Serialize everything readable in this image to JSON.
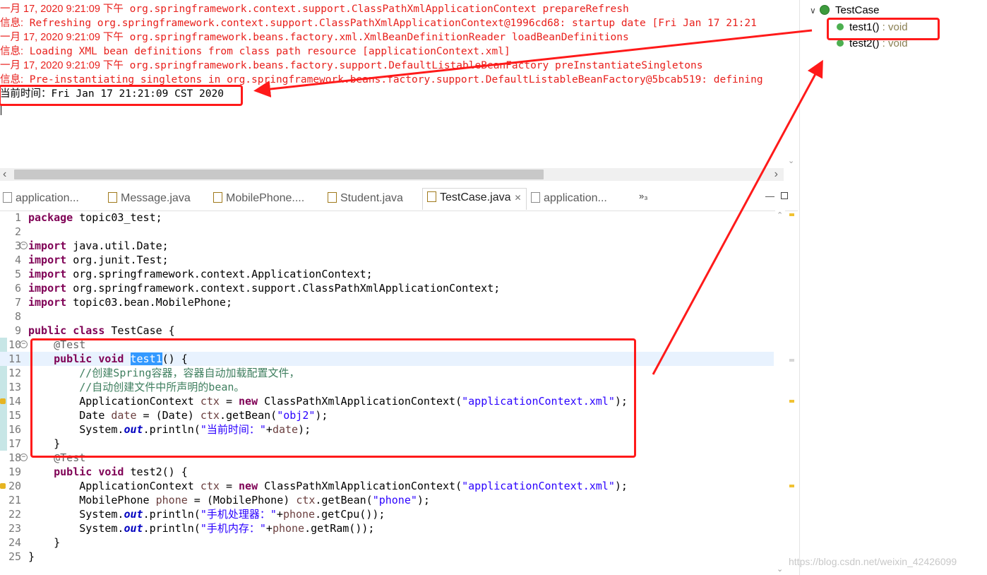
{
  "console": {
    "lines": [
      {
        "prefix": "一月 17, 2020 9:21:09 下午",
        "text": " org.springframework.context.support.ClassPathXmlApplicationContext prepareRefresh"
      },
      {
        "prefix": "信息:",
        "text": " Refreshing org.springframework.context.support.ClassPathXmlApplicationContext@1996cd68: startup date [Fri Jan 17 21:21"
      },
      {
        "prefix": "一月 17, 2020 9:21:09 下午",
        "text": " org.springframework.beans.factory.xml.XmlBeanDefinitionReader loadBeanDefinitions"
      },
      {
        "prefix": "信息:",
        "text": " Loading XML bean definitions from class path resource [applicationContext.xml]"
      },
      {
        "prefix": "一月 17, 2020 9:21:09 下午",
        "text": " org.springframework.beans.factory.support.DefaultListableBeanFactory preInstantiateSingletons"
      },
      {
        "prefix": "信息:",
        "text": " Pre-instantiating singletons in org.springframework.beans.factory.support.DefaultListableBeanFactory@5bcab519: defining"
      }
    ],
    "output": "当前时间：Fri Jan 17 21:21:09 CST 2020"
  },
  "outline": {
    "class_name": "TestCase",
    "methods": [
      {
        "name": "test1()",
        "return": " : void"
      },
      {
        "name": "test2()",
        "return": " : void"
      }
    ]
  },
  "tabs": [
    {
      "label": "application...",
      "active": false
    },
    {
      "label": "Message.java",
      "active": false
    },
    {
      "label": "MobilePhone....",
      "active": false
    },
    {
      "label": "Student.java",
      "active": false
    },
    {
      "label": "TestCase.java",
      "active": true
    },
    {
      "label": "application...",
      "active": false
    }
  ],
  "tab_overflow": "»₃",
  "code": {
    "line_numbers": [
      "1",
      "2",
      "3",
      "4",
      "5",
      "6",
      "7",
      "8",
      "9",
      "10",
      "11",
      "12",
      "13",
      "14",
      "15",
      "16",
      "17",
      "18",
      "19",
      "20",
      "21",
      "22",
      "23",
      "24",
      "25"
    ],
    "l1": {
      "kw": "package",
      "rest": " topic03_test;"
    },
    "l3": {
      "kw": "import",
      "rest": " java.util.Date;"
    },
    "l4": {
      "kw": "import",
      "rest": " org.junit.Test;"
    },
    "l5": {
      "kw": "import",
      "rest": " org.springframework.context.ApplicationContext;"
    },
    "l6": {
      "kw": "import",
      "rest": " org.springframework.context.support.ClassPathXmlApplicationContext;"
    },
    "l7": {
      "kw": "import",
      "rest": " topic03.bean.MobilePhone;"
    },
    "l9": {
      "kw": "public class",
      "rest": " TestCase {"
    },
    "l10": {
      "ann": "    @Test"
    },
    "l11": {
      "kw": "    public void",
      "sp": " ",
      "sel": "test1",
      "rest": "() {"
    },
    "l12": {
      "cm": "        //创建Spring容器，容器自动加载配置文件，"
    },
    "l13": {
      "cm": "        //自动创建文件中所声明的bean。"
    },
    "l14": {
      "a": "        ApplicationContext ",
      "var": "ctx",
      "b": " = ",
      "kw": "new",
      "c": " ClassPathXmlApplicationContext(",
      "str": "\"applicationContext.xml\"",
      "d": ");"
    },
    "l15": {
      "a": "        Date ",
      "var": "date",
      "b": " = (Date) ",
      "var2": "ctx",
      "c": ".getBean(",
      "str": "\"obj2\"",
      "d": ");"
    },
    "l16": {
      "a": "        System.",
      "sf": "out",
      "b": ".println(",
      "str": "\"当前时间：\"",
      "c": "+",
      "var": "date",
      "d": ");"
    },
    "l17": {
      "rest": "    }"
    },
    "l18": {
      "ann": "    @Test"
    },
    "l19": {
      "kw": "    public void",
      "rest": " test2() {"
    },
    "l20": {
      "a": "        ApplicationContext ",
      "var": "ctx",
      "b": " = ",
      "kw": "new",
      "c": " ClassPathXmlApplicationContext(",
      "str": "\"applicationContext.xml\"",
      "d": ");"
    },
    "l21": {
      "a": "        MobilePhone ",
      "var": "phone",
      "b": " = (MobilePhone) ",
      "var2": "ctx",
      "c": ".getBean(",
      "str": "\"phone\"",
      "d": ");"
    },
    "l22": {
      "a": "        System.",
      "sf": "out",
      "b": ".println(",
      "str": "\"手机处理器：\"",
      "c": "+",
      "var": "phone",
      "d": ".getCpu());"
    },
    "l23": {
      "a": "        System.",
      "sf": "out",
      "b": ".println(",
      "str": "\"手机内存：\"",
      "c": "+",
      "var": "phone",
      "d": ".getRam());"
    },
    "l24": {
      "rest": "    }"
    },
    "l25": {
      "rest": "}"
    }
  },
  "watermark": "https://blog.csdn.net/weixin_42426099",
  "colors": {
    "annotation_red": "#ff1a1a",
    "keyword": "#7f0055",
    "string": "#2a00ff",
    "comment": "#3f7f5f",
    "console_red": "#e8201c"
  },
  "icons": [
    "class-icon",
    "method-icon",
    "java-file-icon",
    "xml-file-icon",
    "close-icon",
    "fold-icon",
    "warning-icon"
  ]
}
